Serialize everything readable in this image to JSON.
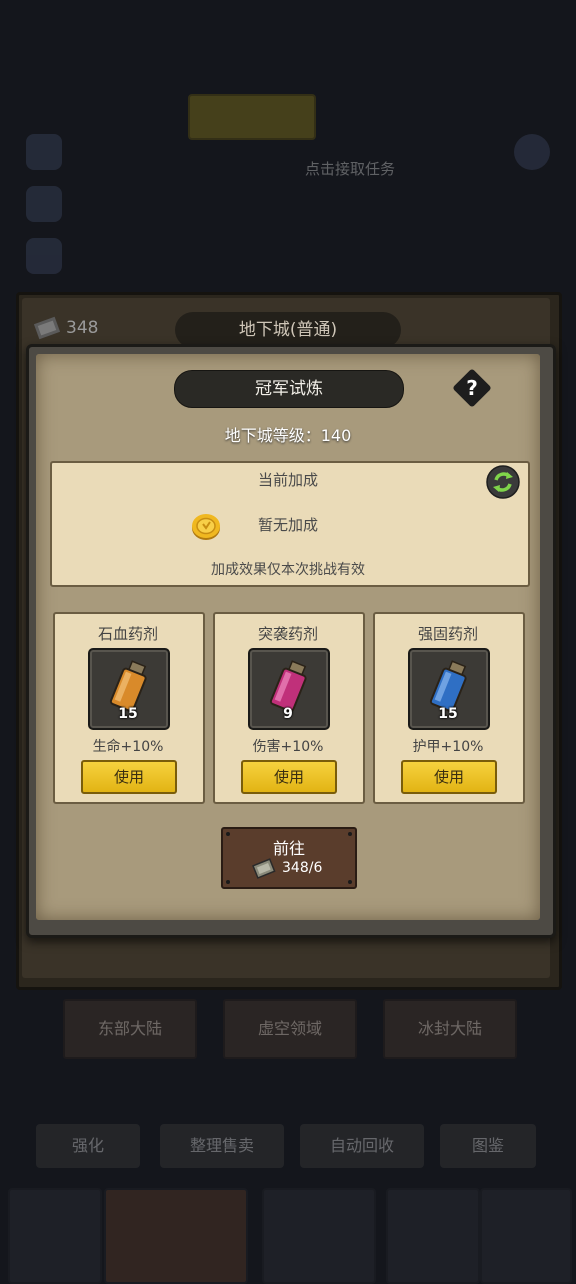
{
  "background": {
    "task_hint": "点击接取任务",
    "regions": [
      "东部大陆",
      "虚空领域",
      "冰封大陆"
    ],
    "bottom_buttons": [
      "强化",
      "整理售卖",
      "自动回收",
      "图鉴"
    ]
  },
  "dungeon_panel": {
    "ticket_count": "348",
    "title": "地下城(普通)"
  },
  "dialog": {
    "title": "冠军试炼",
    "help_label": "?",
    "level_text": "地下城等级：140",
    "bonus": {
      "title": "当前加成",
      "current": "暂无加成",
      "note": "加成效果仅本次挑战有效"
    },
    "potions": [
      {
        "name": "石血药剂",
        "count": "15",
        "effect": "生命+10%",
        "button": "使用",
        "color": "#d98a2a"
      },
      {
        "name": "突袭药剂",
        "count": "9",
        "effect": "伤害+10%",
        "button": "使用",
        "color": "#c0307a"
      },
      {
        "name": "强固药剂",
        "count": "15",
        "effect": "护甲+10%",
        "button": "使用",
        "color": "#2f6fc4"
      }
    ],
    "go": {
      "label": "前往",
      "cost": "348/6"
    }
  },
  "icons": {
    "help": "question-icon",
    "refresh": "refresh-icon",
    "coin": "coin-icon",
    "ticket": "ticket-icon",
    "potion": "potion-bottle-icon"
  }
}
